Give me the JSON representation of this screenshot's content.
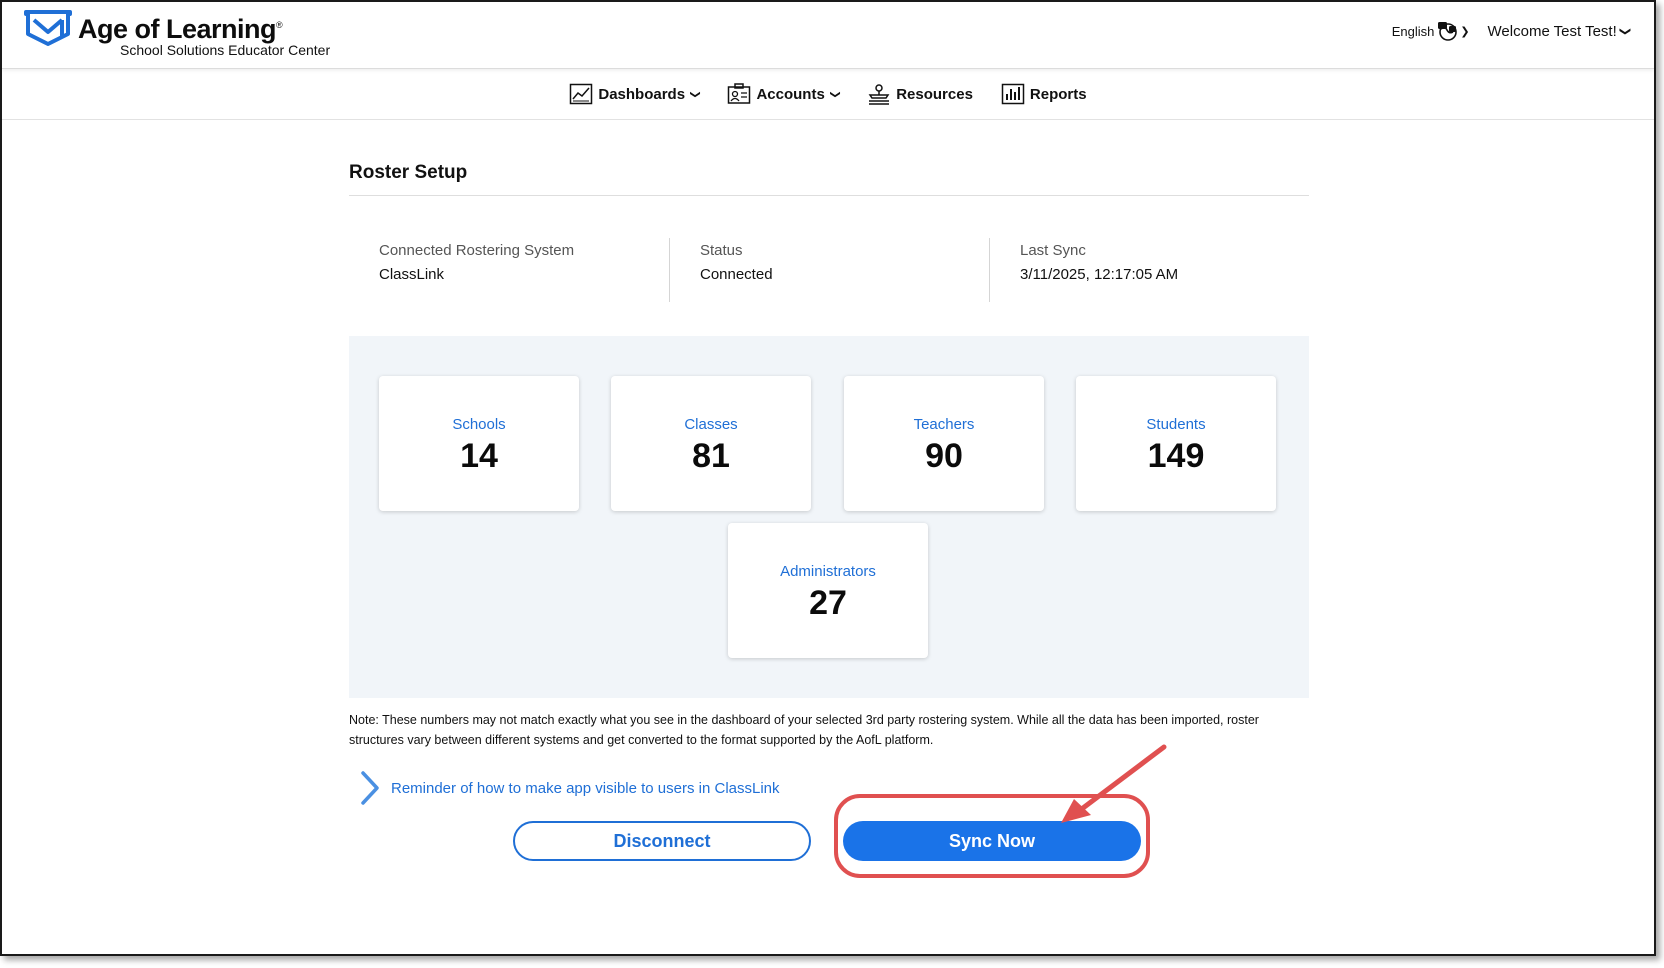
{
  "header": {
    "brand_name": "Age of Learning",
    "brand_reg": "®",
    "brand_sub": "School Solutions Educator Center",
    "language": "English",
    "welcome": "Welcome Test Test!"
  },
  "nav": {
    "items": [
      {
        "label": "Dashboards",
        "icon": "chart-icon",
        "has_dropdown": true
      },
      {
        "label": "Accounts",
        "icon": "accounts-icon",
        "has_dropdown": true
      },
      {
        "label": "Resources",
        "icon": "resources-icon",
        "has_dropdown": false
      },
      {
        "label": "Reports",
        "icon": "reports-icon",
        "has_dropdown": false
      }
    ]
  },
  "main": {
    "title": "Roster Setup",
    "info": [
      {
        "label": "Connected Rostering System",
        "value": "ClassLink"
      },
      {
        "label": "Status",
        "value": "Connected"
      },
      {
        "label": "Last Sync",
        "value": "3/11/2025, 12:17:05 AM"
      }
    ],
    "stats": [
      {
        "label": "Schools",
        "value": "14"
      },
      {
        "label": "Classes",
        "value": "81"
      },
      {
        "label": "Teachers",
        "value": "90"
      },
      {
        "label": "Students",
        "value": "149"
      },
      {
        "label": "Administrators",
        "value": "27"
      }
    ],
    "note": "Note: These numbers may not match exactly what you see in the dashboard of your selected 3rd party rostering system. While all the data has been imported, roster structures vary between different systems and get converted to the format supported by the AofL platform.",
    "reminder": "Reminder of how to make app visible to users in ClassLink",
    "disconnect_label": "Disconnect",
    "sync_label": "Sync Now"
  },
  "colors": {
    "accent": "#1a73e8",
    "link": "#1f6fd6",
    "highlight": "#e05050",
    "panel_bg": "#f1f5f9"
  }
}
